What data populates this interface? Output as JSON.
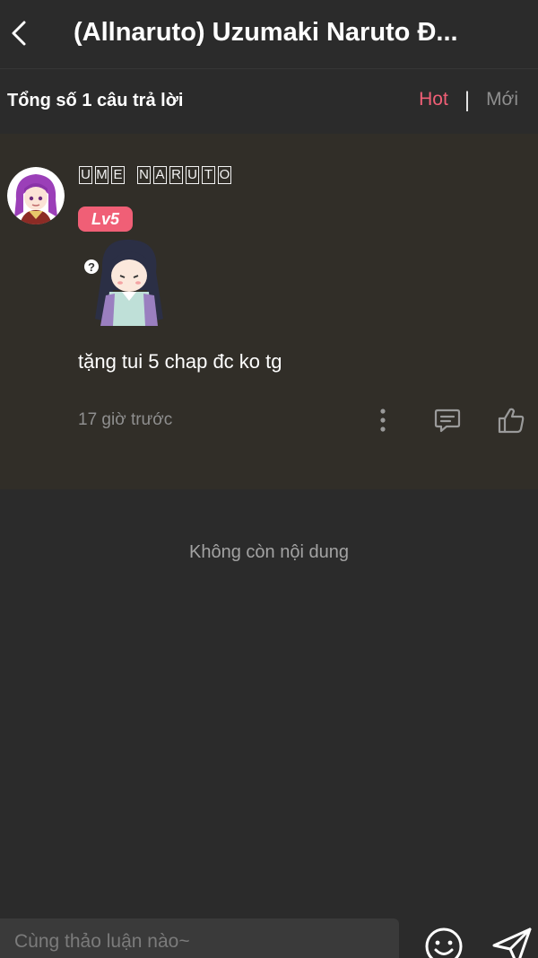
{
  "header": {
    "title": "(Allnaruto) Uzumaki Naruto Đ..."
  },
  "subbar": {
    "total_label": "Tổng số 1 câu trả lời",
    "sort_hot": "Hot",
    "sort_separator": "|",
    "sort_new": "Mới",
    "active_color": "#f05f76"
  },
  "comment": {
    "username_letters_1": [
      "U",
      "M",
      "E"
    ],
    "username_letters_2": [
      "N",
      "A",
      "R",
      "U",
      "T",
      "O"
    ],
    "level": "Lv5",
    "content": "tặng tui 5 chap đc ko tg",
    "time": "17 giờ trước",
    "icons": [
      "more-vertical-icon",
      "reply-icon",
      "thumbs-up-icon"
    ]
  },
  "footer_note": "Không còn nội dung",
  "composer": {
    "placeholder": "Cùng thảo luận nào~"
  }
}
